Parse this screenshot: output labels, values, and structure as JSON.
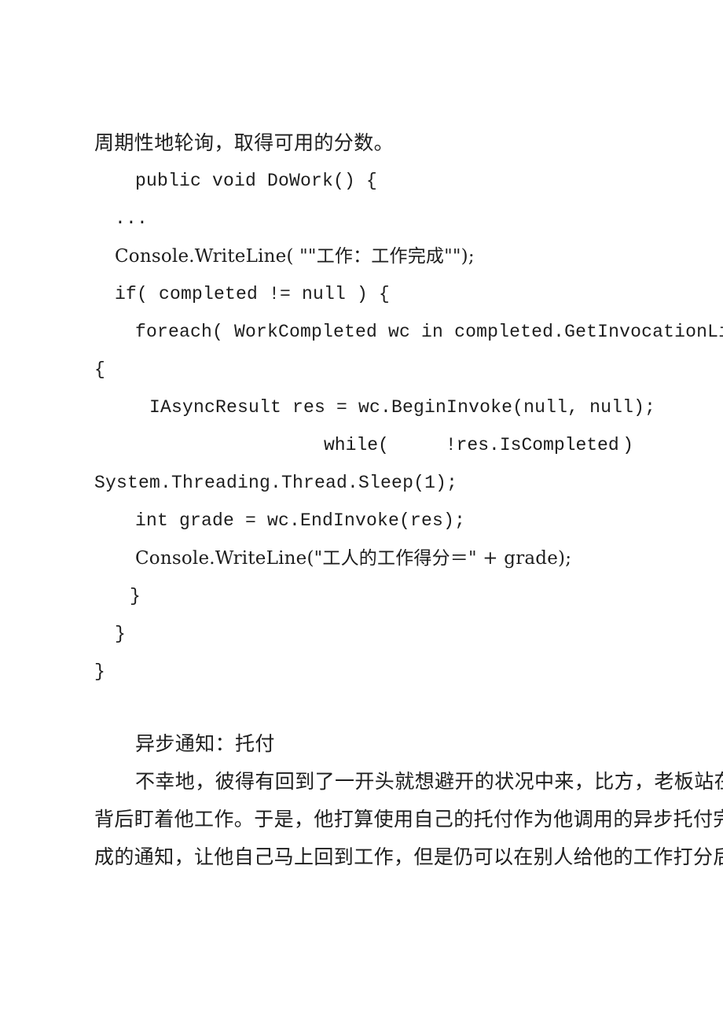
{
  "document": {
    "page_background": "#ffffff",
    "text_color": "#1d1d1d",
    "intro_line": "周期性地轮询，取得可用的分数。",
    "code_block": {
      "lines": [
        {
          "id": "l1",
          "text": "public void DoWork() {",
          "indent": 3
        },
        {
          "id": "l2",
          "text": "...",
          "indent": 1
        },
        {
          "id": "l3",
          "text": "Console.WriteLine( \"\"工作：工作完成\"\");",
          "indent": 1
        },
        {
          "id": "l4",
          "text": "if( completed != null ) {",
          "indent": 1
        },
        {
          "id": "l5",
          "text": "foreach( WorkCompleted wc in completed.GetInvocationList() )",
          "indent": 3
        },
        {
          "id": "l6",
          "text": "{",
          "indent": 0
        },
        {
          "id": "l7",
          "text": "IAsyncResult res = wc.BeginInvoke(null, null);",
          "indent": 4
        },
        {
          "id": "l8",
          "segments": [
            "while(",
            "!res.IsCompleted",
            ")"
          ],
          "justified": true
        },
        {
          "id": "l9",
          "text": "System.Threading.Thread.Sleep(1);",
          "indent": 0
        },
        {
          "id": "l10",
          "text": "int grade = wc.EndInvoke(res);",
          "indent": 3
        },
        {
          "id": "l11",
          "text": "Console.WriteLine(\"工人的工作得分＝\" + grade);",
          "indent": 3
        },
        {
          "id": "l12",
          "text": "}",
          "indent": 2
        },
        {
          "id": "l13",
          "text": "}",
          "indent": 1
        },
        {
          "id": "l14",
          "text": "}",
          "indent": 0
        }
      ]
    },
    "section": {
      "heading": "异步通知：托付",
      "paragraph_lines": [
        "不幸地，彼得有回到了一开头就想避开的状况中来，比方，老板站在",
        "背后盯着他工作。于是，他打算使用自己的托付作为他调用的异步托付完",
        "成的通知，让他自己马上回到工作，但是仍可以在别人给他的工作打分后"
      ]
    }
  }
}
